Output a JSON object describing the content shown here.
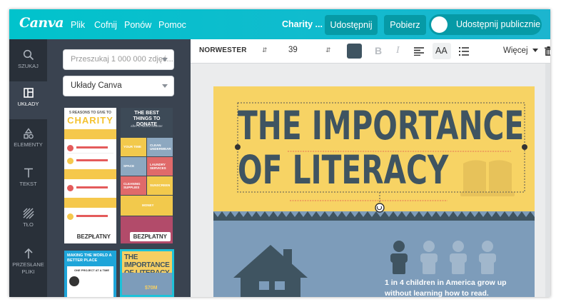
{
  "topbar": {
    "logo": "Canva",
    "menu": [
      "Plik",
      "Cofnij",
      "Ponów",
      "Pomoc"
    ],
    "design_title": "Charity ...",
    "share_label": "Udostępnij",
    "download_label": "Pobierz",
    "public_share_label": "Udostępnij publicznie"
  },
  "rail": {
    "items": [
      {
        "label": "SZUKAJ",
        "icon": "search-icon"
      },
      {
        "label": "UKŁADY",
        "icon": "layouts-icon"
      },
      {
        "label": "ELEMENTY",
        "icon": "elements-icon"
      },
      {
        "label": "TEKST",
        "icon": "text-icon"
      },
      {
        "label": "TŁO",
        "icon": "background-icon"
      },
      {
        "label": "PRZESŁANE PLIKI",
        "icon": "upload-icon"
      }
    ]
  },
  "panel": {
    "search_placeholder": "Przeszukaj 1 000 000 zdjęć...",
    "layout_select": "Układy Canva",
    "free_badge": "BEZPŁATNY",
    "thumb1": {
      "line1": "5 REASONS TO GIVE TO",
      "title": "CHARITY"
    },
    "thumb2": {
      "title": "THE BEST THINGS TO DONATE",
      "subtitle": "after a natural disaster",
      "cells": [
        "YOUR TIME",
        "CLEAN UNDERWEAR",
        "SPACE",
        "LAUNDRY SERVICES",
        "CLEANING SUPPLIES",
        "SUNSCREEN",
        "MONEY"
      ]
    },
    "thumb3": {
      "title": "MAKING THE WORLD A BETTER PLACE",
      "subtitle": "ONE PROJECT AT A TIME"
    },
    "thumb4": {
      "title": "THE IMPORTANCE OF LITERACY",
      "stat": "$70M"
    }
  },
  "toolbar": {
    "font": "NORWESTER",
    "size": "39",
    "bold": "B",
    "italic": "I",
    "case": "AA",
    "more": "Więcej",
    "text_color": "#3f5461"
  },
  "design": {
    "title_line1": "THE IMPORTANCE",
    "title_line2": "OF LITERACY",
    "stat": "1 in 4 children in America grow up without learning how to read."
  },
  "colors": {
    "brand": "#01c3cc",
    "yellow": "#f7d364",
    "blue": "#7d9cba",
    "slate": "#3f5461"
  }
}
